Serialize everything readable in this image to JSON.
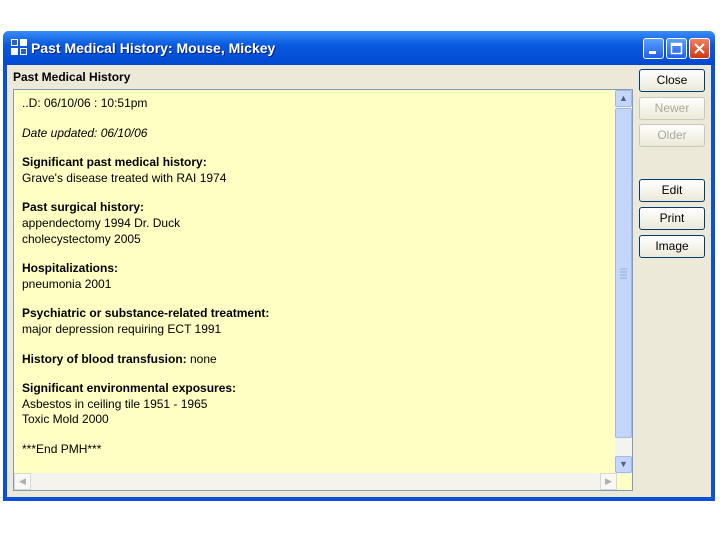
{
  "window": {
    "title": "Past Medical History: Mouse, Mickey"
  },
  "panel": {
    "label": "Past Medical History"
  },
  "record": {
    "id_line": "..D: 06/10/06 : 10:51pm",
    "date_updated": "Date updated:  06/10/06",
    "sections": [
      {
        "heading": "Significant past medical history:",
        "lines": [
          "Grave's disease treated with RAI 1974"
        ]
      },
      {
        "heading": "Past surgical history:",
        "lines": [
          "appendectomy 1994  Dr. Duck",
          "cholecystectomy  2005"
        ]
      },
      {
        "heading": "Hospitalizations:",
        "lines": [
          "pneumonia  2001"
        ]
      },
      {
        "heading": "Psychiatric or substance-related treatment:",
        "lines": [
          "major depression requiring ECT 1991"
        ]
      },
      {
        "heading": "History of blood transfusion:",
        "inline": " none"
      },
      {
        "heading": "Significant environmental exposures:",
        "lines": [
          "Asbestos in ceiling tile 1951 - 1965",
          "Toxic Mold 2000"
        ]
      }
    ],
    "footer": "***End PMH***"
  },
  "buttons": {
    "close": "Close",
    "newer": "Newer",
    "older": "Older",
    "edit": "Edit",
    "print": "Print",
    "image": "Image"
  },
  "colors": {
    "title_bar": "#0a5ae0",
    "text_background": "#ffffc4",
    "dialog_face": "#ece9d8"
  }
}
